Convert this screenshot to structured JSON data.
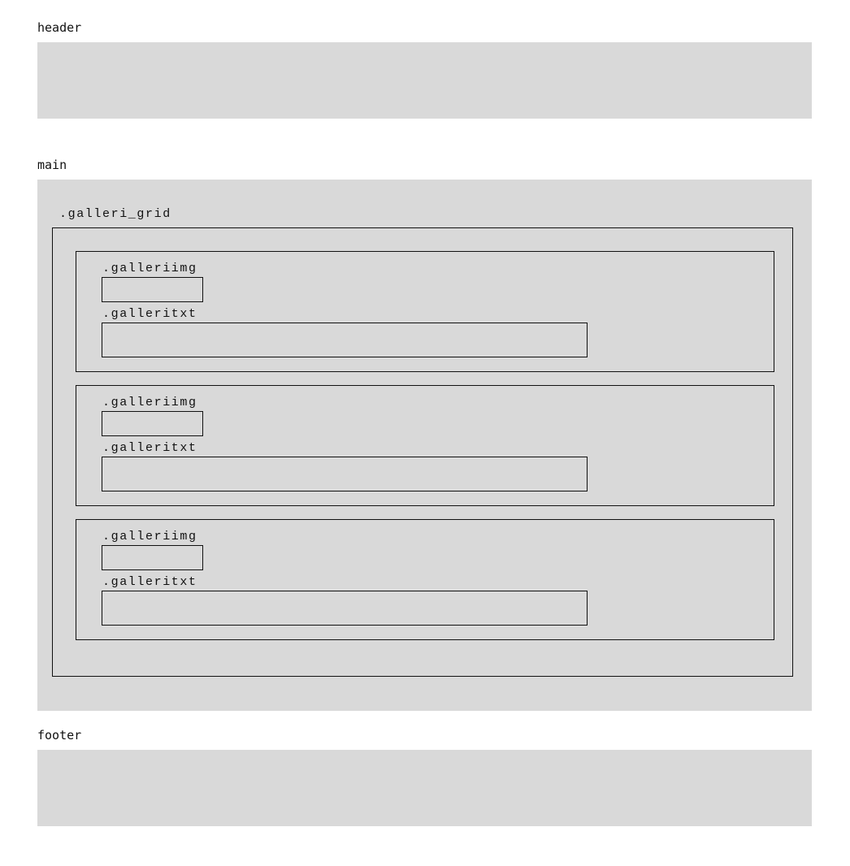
{
  "sections": {
    "header": {
      "label": "header"
    },
    "main": {
      "label": "main"
    },
    "footer": {
      "label": "footer"
    }
  },
  "gallery_grid": {
    "label": ".galleri_grid",
    "items": [
      {
        "img_label": ".galleriimg",
        "txt_label": ".galleritxt"
      },
      {
        "img_label": ".galleriimg",
        "txt_label": ".galleritxt"
      },
      {
        "img_label": ".galleriimg",
        "txt_label": ".galleritxt"
      }
    ]
  },
  "colors": {
    "band": "#d9d9d9",
    "outline": "#111111",
    "background": "#ffffff"
  }
}
